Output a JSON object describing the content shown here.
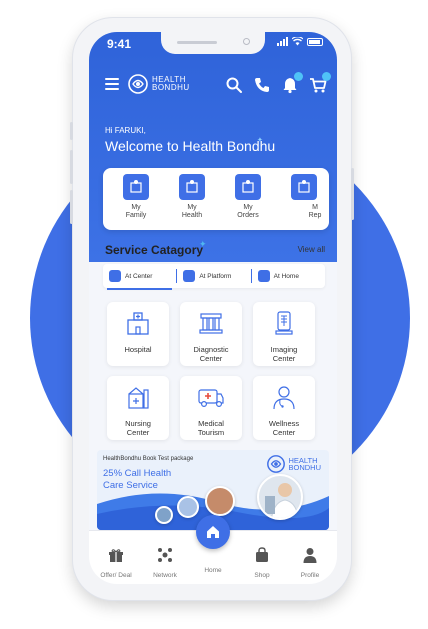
{
  "status_bar": {
    "time": "9:41"
  },
  "header": {
    "brand_line1": "HEALTH",
    "brand_line2": "BONDHU",
    "greeting": "Hi FARUKI,",
    "welcome": "Welcome to Health Bondhu"
  },
  "quick_actions": [
    {
      "label1": "My",
      "label2": "Family",
      "icon": "family-icon"
    },
    {
      "label1": "My",
      "label2": "Health",
      "icon": "health-icon"
    },
    {
      "label1": "My",
      "label2": "Orders",
      "icon": "orders-icon"
    },
    {
      "label1": "M",
      "label2": "Rep",
      "icon": "reports-icon"
    }
  ],
  "services": {
    "title": "Service Catagory",
    "view_all": "View all",
    "tabs": [
      "At Center",
      "At Platform",
      "At Home"
    ],
    "active_tab": "At Center",
    "items": [
      {
        "line1": "Hospital",
        "line2": ""
      },
      {
        "line1": "Diagnostic",
        "line2": "Center"
      },
      {
        "line1": "Imaging",
        "line2": "Center"
      },
      {
        "line1": "Nursing",
        "line2": "Center"
      },
      {
        "line1": "Medical",
        "line2": "Tourism"
      },
      {
        "line1": "Wellness",
        "line2": "Center"
      }
    ]
  },
  "banner": {
    "small": "HealthBondhu Book Test package",
    "line1": "25% Call Health",
    "line2": "Care Service",
    "logo_line1": "HEALTH",
    "logo_line2": "BONDHU"
  },
  "bottom_nav": [
    "Offer/ Deal",
    "Network",
    "Home",
    "Shop",
    "Profile"
  ],
  "colors": {
    "primary": "#3f6fe6",
    "accent": "#4fc3f7",
    "background_circle": "#3f6fe6"
  }
}
